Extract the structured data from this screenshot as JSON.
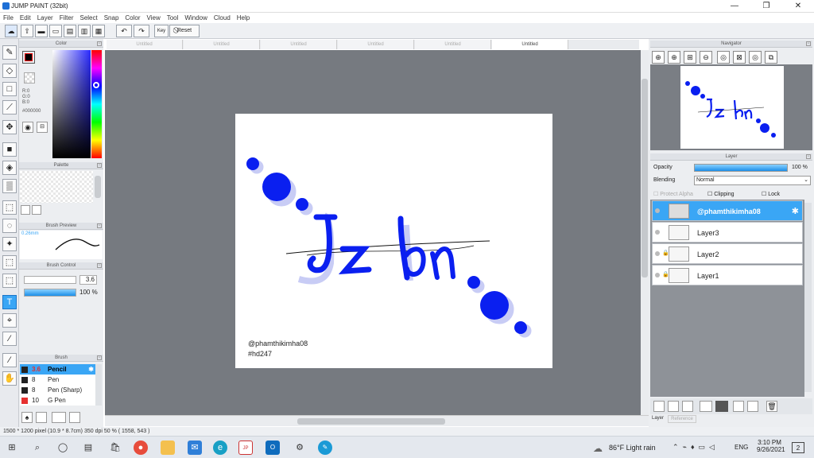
{
  "window": {
    "title": "JUMP PAINT (32bit)"
  },
  "menu": [
    "File",
    "Edit",
    "Layer",
    "Filter",
    "Select",
    "Snap",
    "Color",
    "View",
    "Tool",
    "Window",
    "Cloud",
    "Help"
  ],
  "toolbar": {
    "key_label": "Key",
    "reset_label": "Reset"
  },
  "doc_tabs": [
    "Untitled",
    "Untitled",
    "Untitled",
    "Untitled",
    "Untitled",
    "Untitled"
  ],
  "color_panel": {
    "title": "Color",
    "r": "R:0",
    "g": "G:0",
    "b": "B:0",
    "hex": "#000000",
    "foreground": "#000000"
  },
  "palette_panel": {
    "title": "Palette"
  },
  "brush_preview": {
    "title": "Brush Preview",
    "size_label": "0.26mm"
  },
  "brush_control": {
    "title": "Brush Control",
    "size_value": "3.6",
    "opacity_value": "100 %"
  },
  "brush_list": {
    "title": "Brush",
    "items": [
      {
        "size": "3.6",
        "name": "Pencil",
        "color": "#222222",
        "selected": true
      },
      {
        "size": "8",
        "name": "Pen",
        "color": "#222222"
      },
      {
        "size": "8",
        "name": "Pen (Sharp)",
        "color": "#222222"
      },
      {
        "size": "10",
        "name": "G Pen",
        "color": "#e63030"
      }
    ]
  },
  "canvas": {
    "handle": "@phamthikimha08",
    "tag": "#hd247",
    "main_text": "Jz bn",
    "accent": "#0a1ff0",
    "shadow": "#c8ccf5"
  },
  "navigator": {
    "title": "Navigator"
  },
  "layer_panel": {
    "title": "Layer",
    "opacity_label": "Opacity",
    "opacity_value": "100 %",
    "blending_label": "Blending",
    "blending_value": "Normal",
    "protect_alpha": "Protect Alpha",
    "clipping": "Clipping",
    "lock": "Lock",
    "layers": [
      "@phamthikimha08",
      "Layer3",
      "Layer2",
      "Layer1"
    ]
  },
  "bottom_tabs": {
    "layer": "Layer",
    "reference": "Reference"
  },
  "status": "1500 * 1200 pixel   (10.9 * 8.7cm)   350 dpi   50 %   ( 1558, 543 )",
  "taskbar": {
    "weather": "86°F  Light rain",
    "lang": "ENG",
    "time": "3:10 PM",
    "date": "9/26/2021",
    "notif_count": "2"
  }
}
